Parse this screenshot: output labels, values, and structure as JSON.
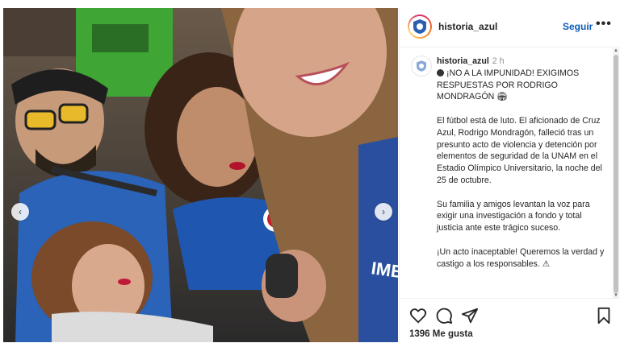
{
  "post": {
    "username": "historia_azul",
    "follow_label": "Seguir",
    "more_label": "•••",
    "time": "2 h",
    "caption_lines": [
      "¡NO A LA IMPUNIDAD! EXIGIMOS RESPUESTAS POR RODRIGO MONDRAGÓN",
      "El fútbol está de luto. El aficionado de Cruz Azul, Rodrigo Mondragón, falleció tras un presunto acto de violencia y detención por elementos de seguridad de la UNAM en el Estadio Olímpico Universitario, la noche del 25 de octubre.",
      "Su familia y amigos levantan la voz para exigir una investigación a fondo y total justicia ante este trágico suceso.",
      "¡Un acto inaceptable! Queremos la verdad y castigo a los responsables."
    ],
    "likes": "1396 Me gusta"
  },
  "icons": {
    "like": "heart-icon",
    "comment": "comment-icon",
    "share": "send-icon",
    "save": "bookmark-icon",
    "prev": "chevron-left-icon",
    "next": "chevron-right-icon"
  },
  "colors": {
    "follow": "#0a5bb5",
    "text": "#262626",
    "muted": "#8e8e8e"
  }
}
